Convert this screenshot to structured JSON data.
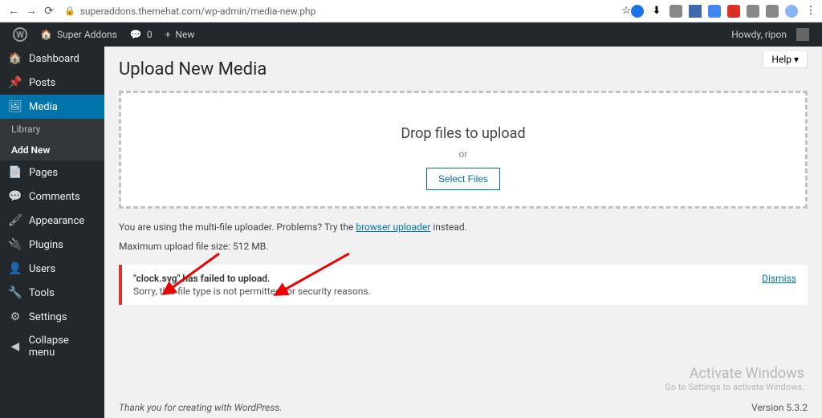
{
  "browser": {
    "url": "superaddons.themehat.com/wp-admin/media-new.php"
  },
  "adminbar": {
    "site_name": "Super Addons",
    "comments": "0",
    "new": "New",
    "howdy": "Howdy, ripon"
  },
  "sidebar": {
    "items": [
      {
        "label": "Dashboard",
        "icon": "🏠"
      },
      {
        "label": "Posts",
        "icon": "📌"
      },
      {
        "label": "Media",
        "icon": "🖼",
        "active": true
      },
      {
        "label": "Pages",
        "icon": "📄"
      },
      {
        "label": "Comments",
        "icon": "💬"
      },
      {
        "label": "Appearance",
        "icon": "🖌"
      },
      {
        "label": "Plugins",
        "icon": "🔌"
      },
      {
        "label": "Users",
        "icon": "👤"
      },
      {
        "label": "Tools",
        "icon": "🔧"
      },
      {
        "label": "Settings",
        "icon": "⚙"
      },
      {
        "label": "Collapse menu",
        "icon": "◀"
      }
    ],
    "media_sub": [
      {
        "label": "Library"
      },
      {
        "label": "Add New",
        "current": true
      }
    ]
  },
  "main": {
    "help": "Help ▾",
    "title": "Upload New Media",
    "drop_text": "Drop files to upload",
    "or": "or",
    "select_btn": "Select Files",
    "hint_prefix": "You are using the multi-file uploader. Problems? Try the ",
    "hint_link": "browser uploader",
    "hint_suffix": " instead.",
    "limit": "Maximum upload file size: 512 MB.",
    "notice": {
      "title": "\"clock.svg\" has failed to upload.",
      "detail": "Sorry, this file type is not permitted for security reasons.",
      "dismiss": "Dismiss"
    },
    "footer_thanks_prefix": "Thank you for creating with ",
    "footer_thanks_link": "WordPress",
    "footer_thanks_suffix": ".",
    "version": "Version 5.3.2"
  },
  "windows": {
    "line1": "Activate Windows",
    "line2": "Go to Settings to activate Windows."
  }
}
